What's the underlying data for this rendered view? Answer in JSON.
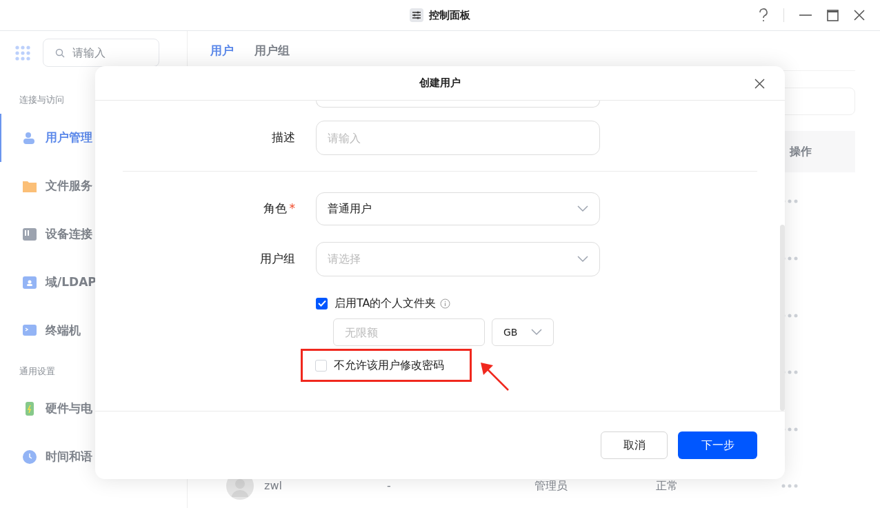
{
  "window": {
    "title": "控制面板"
  },
  "sidebar": {
    "search_placeholder": "请输入",
    "sections": [
      {
        "heading": "连接与访问",
        "items": [
          {
            "label": "用户管理",
            "kind": "users",
            "selected": true
          },
          {
            "label": "文件服务",
            "kind": "folder",
            "selected": false
          },
          {
            "label": "设备连接",
            "kind": "device",
            "selected": false
          },
          {
            "label": "域/LDAP",
            "kind": "ldap",
            "selected": false
          },
          {
            "label": "终端机",
            "kind": "terminal",
            "selected": false
          }
        ]
      },
      {
        "heading": "通用设置",
        "items": [
          {
            "label": "硬件与电",
            "kind": "battery",
            "selected": false
          },
          {
            "label": "时间和语",
            "kind": "clock",
            "selected": false
          }
        ]
      }
    ]
  },
  "tabs": [
    {
      "label": "用户",
      "selected": true
    },
    {
      "label": "用户组",
      "selected": false
    }
  ],
  "table": {
    "columns": [
      "操作"
    ],
    "rows": [
      {
        "kind": "hidden"
      },
      {
        "kind": "hidden"
      },
      {
        "kind": "hidden"
      },
      {
        "kind": "hidden"
      },
      {
        "kind": "hidden"
      },
      {
        "kind": "user",
        "name": "zwl",
        "description": "-",
        "role": "管理员",
        "status": "正常"
      }
    ]
  },
  "dialog": {
    "title": "创建用户",
    "description": {
      "label": "描述",
      "placeholder": "请输入"
    },
    "role": {
      "label": "角色",
      "required_mark": "*",
      "value": "普通用户"
    },
    "group": {
      "label": "用户组",
      "placeholder": "请选择"
    },
    "home_folder": {
      "label": "启用TA的个人文件夹",
      "checked": true,
      "quota_placeholder": "无限额",
      "unit": "GB"
    },
    "lock_password": {
      "label": "不允许该用户修改密码",
      "checked": false,
      "highlighted": true
    },
    "buttons": {
      "cancel": "取消",
      "next": "下一步"
    }
  }
}
